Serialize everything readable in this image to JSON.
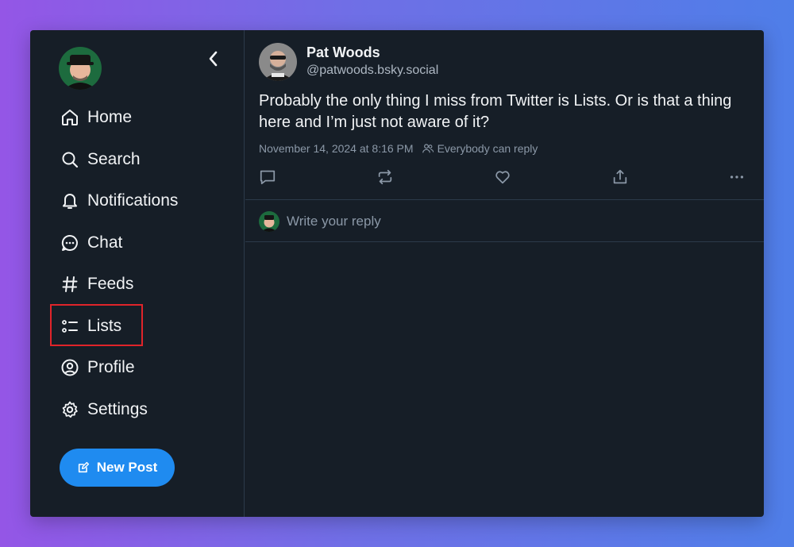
{
  "nav": {
    "items": [
      {
        "label": "Home",
        "icon": "home-icon"
      },
      {
        "label": "Search",
        "icon": "search-icon"
      },
      {
        "label": "Notifications",
        "icon": "bell-icon"
      },
      {
        "label": "Chat",
        "icon": "chat-icon"
      },
      {
        "label": "Feeds",
        "icon": "hash-icon"
      },
      {
        "label": "Lists",
        "icon": "list-icon"
      },
      {
        "label": "Profile",
        "icon": "profile-icon"
      },
      {
        "label": "Settings",
        "icon": "gear-icon"
      }
    ],
    "highlighted": "Lists"
  },
  "new_post": {
    "label": "New Post",
    "icon": "edit-icon"
  },
  "post": {
    "author_name": "Pat Woods",
    "author_handle": "@patwoods.bsky.social",
    "text": "Probably the only thing I miss from Twitter is Lists. Or is that a thing here and I’m just not aware of it?",
    "timestamp": "November 14, 2024 at 8:16 PM",
    "reply_setting": "Everybody can reply"
  },
  "reply": {
    "placeholder": "Write your reply"
  },
  "colors": {
    "background": "#161e27",
    "accent": "#1f8bf0",
    "highlight_box": "#e0242a",
    "text_primary": "#f1f3f5",
    "text_muted": "#8b98a7"
  }
}
